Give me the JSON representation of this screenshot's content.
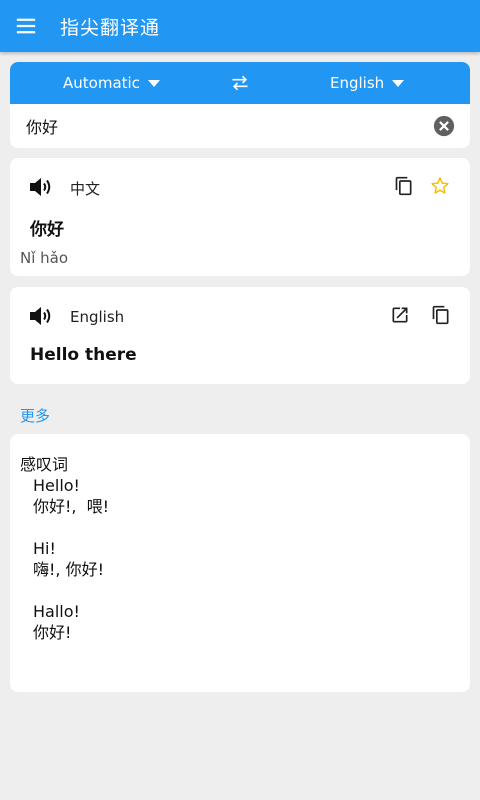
{
  "app": {
    "title": "指尖翻译通"
  },
  "languages": {
    "source": "Automatic",
    "target": "English"
  },
  "input": {
    "value": "你好"
  },
  "source_card": {
    "lang": "中文",
    "text": "你好",
    "pinyin": "Nǐ hǎo"
  },
  "target_card": {
    "lang": "English",
    "text": "Hello there"
  },
  "more": {
    "label": "更多",
    "part_of_speech": "感叹词",
    "entries": [
      {
        "word": "Hello!",
        "meaning": "你好!,  喂!"
      },
      {
        "word": "Hi!",
        "meaning": "嗨!, 你好!"
      },
      {
        "word": "Hallo!",
        "meaning": "你好!"
      }
    ]
  },
  "colors": {
    "primary": "#2196f3",
    "favorite": "#f2c200",
    "background": "#eeeeee"
  }
}
